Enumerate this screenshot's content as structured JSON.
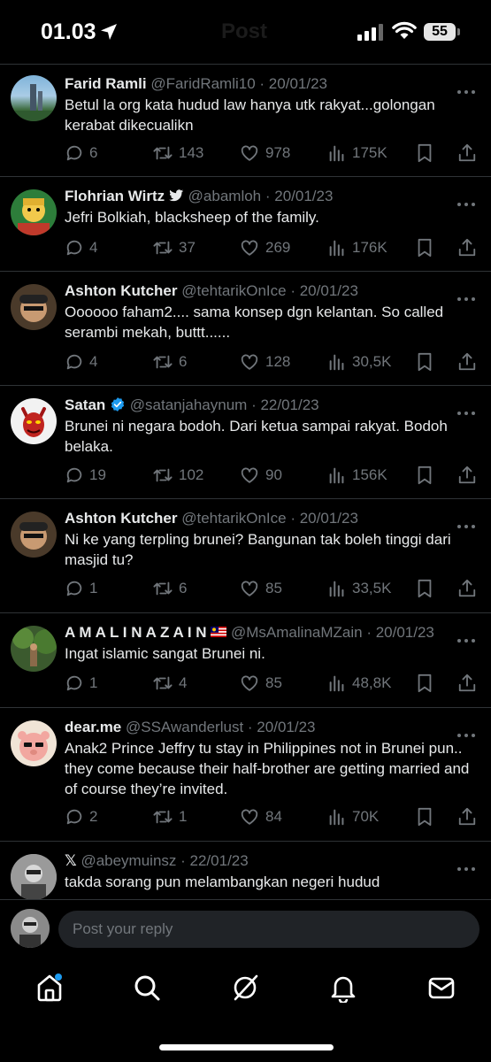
{
  "status": {
    "time": "01.03",
    "battery": "55",
    "ghost_title": "Post"
  },
  "tweets": [
    {
      "name": "Farid Ramli",
      "badge": "",
      "handle": "@FaridRamli10",
      "date": "· 20/01/23",
      "text": "Betul la org kata hudud law hanya utk rakyat...golongan kerabat dikecualikn",
      "replies": "6",
      "reposts": "143",
      "likes": "978",
      "views": "175K"
    },
    {
      "name": "Flohrian Wirtz",
      "badge": "bird",
      "handle": "@abamloh",
      "date": "· 20/01/23",
      "text": "Jefri Bolkiah, blacksheep of the family.",
      "replies": "4",
      "reposts": "37",
      "likes": "269",
      "views": "176K"
    },
    {
      "name": "Ashton Kutcher",
      "badge": "",
      "handle": "@tehtarikOnIce",
      "date": "· 20/01/23",
      "text": "Oooooo faham2.... sama konsep dgn kelantan. So called serambi mekah, buttt......",
      "replies": "4",
      "reposts": "6",
      "likes": "128",
      "views": "30,5K"
    },
    {
      "name": "Satan",
      "badge": "verified",
      "handle": "@satanjahaynum",
      "date": "· 22/01/23",
      "text": "Brunei ni negara bodoh. Dari ketua sampai rakyat. Bodoh belaka.",
      "replies": "19",
      "reposts": "102",
      "likes": "90",
      "views": "156K"
    },
    {
      "name": "Ashton Kutcher",
      "badge": "",
      "handle": "@tehtarikOnIce",
      "date": "· 20/01/23",
      "text": "Ni ke yang terpling brunei? Bangunan tak boleh tinggi dari masjid tu?",
      "replies": "1",
      "reposts": "6",
      "likes": "85",
      "views": "33,5K"
    },
    {
      "name": "A M A L I N A Z A I N",
      "badge": "flag",
      "handle": "@MsAmalinaMZain",
      "date": "· 20/01/23",
      "text": "Ingat islamic sangat Brunei ni.",
      "replies": "1",
      "reposts": "4",
      "likes": "85",
      "views": "48,8K"
    },
    {
      "name": "dear.me",
      "badge": "",
      "handle": "@SSAwanderlust",
      "date": "· 20/01/23",
      "text": "Anak2 Prince Jeffry tu stay in Philippines not in Brunei pun.. they come because their half-brother are getting married and of course they’re invited.",
      "replies": "2",
      "reposts": "1",
      "likes": "84",
      "views": "70K"
    },
    {
      "name": "",
      "badge": "x",
      "handle": "@abeymuinsz",
      "date": "· 22/01/23",
      "text": "takda sorang pun melambangkan negeri hudud",
      "replies": "",
      "reposts": "",
      "likes": "",
      "views": ""
    }
  ],
  "reply": {
    "placeholder": "Post your reply"
  },
  "icons": [
    "location-arrow-icon",
    "signal-icon",
    "wifi-icon",
    "battery-icon",
    "more-icon",
    "reply-icon",
    "repost-icon",
    "like-icon",
    "views-icon",
    "bookmark-icon",
    "share-icon",
    "home-icon",
    "search-icon",
    "grok-icon",
    "bell-icon",
    "mail-icon"
  ],
  "colors": {
    "background": "#000000",
    "text": "#e7e9ea",
    "muted": "#71767b",
    "divider": "#2f3336",
    "verified": "#1d9bf0",
    "notification_dot": "#1d9bf0"
  }
}
